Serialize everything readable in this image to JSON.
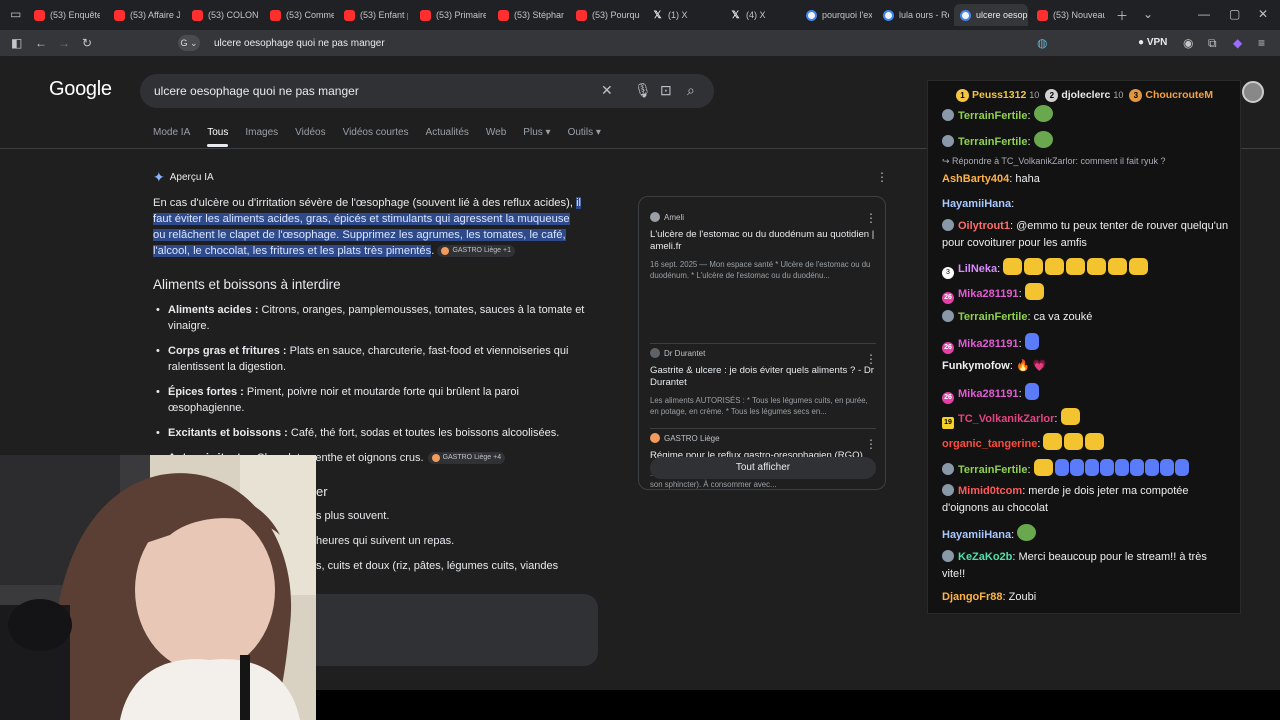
{
  "browser": {
    "tabs": [
      {
        "label": "(53) Enquête...",
        "icon": "youtube-icon",
        "left": 0
      },
      {
        "label": "(53) Affaire Je...",
        "icon": "youtube-icon"
      },
      {
        "label": "(53) COLONEL...",
        "icon": "youtube-icon"
      },
      {
        "label": "(53) Commen...",
        "icon": "youtube-icon"
      },
      {
        "label": "(53) Enfant pe...",
        "icon": "youtube-icon"
      },
      {
        "label": "(53) Primaire",
        "icon": "youtube-icon"
      },
      {
        "label": "(53) Stéphane...",
        "icon": "youtube-icon"
      },
      {
        "label": "(53) Pourquoi...",
        "icon": "youtube-icon"
      },
      {
        "label": "(1) X",
        "icon": "x-icon"
      },
      {
        "label": "(4) X",
        "icon": "x-icon"
      },
      {
        "label": "pourquoi l'ext...",
        "icon": "google-icon"
      },
      {
        "label": "lula ours - Re...",
        "icon": "google-icon"
      },
      {
        "label": "ulcere oesoph...",
        "icon": "google-icon",
        "active": true
      },
      {
        "label": "(53) Nouveau...",
        "icon": "youtube-icon"
      }
    ],
    "address_url": "ulcere oesophage quoi ne pas manger",
    "vpn_label": "VPN"
  },
  "google": {
    "logo": "Google",
    "query": "ulcere oesophage quoi ne pas manger",
    "nav_tabs": [
      "Mode IA",
      "Tous",
      "Images",
      "Vidéos",
      "Vidéos courtes",
      "Actualités",
      "Web",
      "Plus ▾",
      "Outils ▾"
    ],
    "ai_label": "Aperçu IA",
    "intro_plain": "En cas d'ulcère ou d'irritation sévère de l'œsophage (souvent lié à des reflux acides), ",
    "intro_highlight": "il faut éviter les aliments acides, gras, épicés et stimulants qui agressent la muqueuse ou relâchent le clapet de l'œsophage. Supprimez les agrumes, les tomates, le café, l'alcool, le chocolat, les fritures et les plats très pimentés",
    "intro_end": ".",
    "intro_chip": "GASTRO Liège +1",
    "section_title": "Aliments et boissons à interdire",
    "bullets": [
      {
        "bold": "Aliments acides :",
        "text": " Citrons, oranges, pamplemousses, tomates, sauces à la tomate et vinaigre."
      },
      {
        "bold": "Corps gras et fritures :",
        "text": " Plats en sauce, charcuterie, fast-food et viennoiseries qui ralentissent la digestion."
      },
      {
        "bold": "Épices fortes :",
        "text": " Piment, poivre noir et moutarde forte qui brûlent la paroi œsophagienne."
      },
      {
        "bold": "Excitants et boissons :",
        "text": " Café, thé fort, sodas et toutes les boissons alcoolisées."
      },
      {
        "bold": "Autres irritants :",
        "text": " Chocolat, menthe et oignons crus."
      }
    ],
    "bullet_chip": "GASTRO Liège +4",
    "partial_heading": "er",
    "partial_lines": [
      "s plus souvent.",
      "heures qui suivent un repas.",
      "s, cuits et doux (riz, pâtes, légumes cuits, viandes"
    ],
    "sources": [
      {
        "site": "Ameli",
        "title": "L'ulcère de l'estomac ou du duodénum au quotidien | ameli.fr",
        "desc": "16 sept. 2025 — Mon espace santé * Ulcère de l'estomac ou du duodénum. * L'ulcère de l'estomac ou du duodénu...",
        "color": "#9aa0a6"
      },
      {
        "site": "Dr Durantet",
        "title": "Gastrite & ulcere : je dois éviter quels aliments ? - Dr Durantet",
        "desc": "Les aliments AUTORISÉS : * Tous les légumes cuits, en purée, en potage, en crème. * Tous les légumes secs en...",
        "color": "#5f6368"
      },
      {
        "site": "GASTRO Liège",
        "title": "Régime pour le reflux gastro-oresophagien (RGO)",
        "desc": "... des lésions de l'œsophage et nuit au bon fonctionnement de son sphincter). À consommer avec...",
        "color": "#f29b5d"
      }
    ],
    "show_all": "Tout afficher"
  },
  "chat": {
    "top": [
      {
        "rank": "1",
        "name": "Peuss1312",
        "count": "10",
        "color": "#f5c542",
        "rank_color": "#f5c542"
      },
      {
        "rank": "2",
        "name": "djoleclerc",
        "count": "10",
        "color": "#e8e8e8",
        "rank_color": "#d0d0d0"
      },
      {
        "rank": "3",
        "name": "ChoucrouteM",
        "count": "",
        "color": "#f5a142",
        "rank_color": "#e2963f"
      }
    ],
    "messages": [
      {
        "user": "TerrainFertile",
        "color": "#8fd14f",
        "text": ":",
        "badge": "bot",
        "emotes": [
          "frog"
        ]
      },
      {
        "user": "TerrainFertile",
        "color": "#8fd14f",
        "text": ":",
        "badge": "bot",
        "emotes": [
          "frog"
        ]
      },
      {
        "reply": "↪ Répondre à TC_VolkanikZarlor: comment il fait ryuk ?"
      },
      {
        "user": "AshBarty404",
        "color": "#ffb347",
        "text": ": haha"
      },
      {
        "user": "HayamiiHana",
        "color": "#a9c7ff",
        "text": ":"
      },
      {
        "user": "Oilytrout1",
        "color": "#ff6b6b",
        "text": ": @emmo tu peux tenter de rouver quelqu'un pour covoiturer pour les amfis",
        "badge": "bot"
      },
      {
        "user": "LilNeka",
        "color": "#d68cff",
        "text": ":",
        "badge": "three",
        "badge_text": "3",
        "emotes": [
          "cat",
          "cat",
          "cat",
          "cat",
          "cat",
          "cat",
          "cat"
        ]
      },
      {
        "user": "Mika281191",
        "color": "#e05bd1",
        "text": ":",
        "badge": "sub",
        "badge_text": "26",
        "emotes": [
          "cat"
        ]
      },
      {
        "user": "TerrainFertile",
        "color": "#8fd14f",
        "text": ": ca va zouké",
        "badge": "bot"
      },
      {
        "user": "Mika281191",
        "color": "#e05bd1",
        "text": ":",
        "badge": "sub",
        "badge_text": "26",
        "emotes": [
          "blue"
        ]
      },
      {
        "user": "Funkymofow",
        "color": "#efeff1",
        "text": ": 🔥 💗"
      },
      {
        "user": "Mika281191",
        "color": "#e05bd1",
        "text": ":",
        "badge": "sub",
        "badge_text": "26",
        "emotes": [
          "blue"
        ]
      },
      {
        "user": "TC_VolkanikZarlor",
        "color": "#e5437f",
        "text": ":",
        "badge": "yel",
        "badge_text": "19",
        "emotes": [
          "cat"
        ]
      },
      {
        "user": "organic_tangerine",
        "color": "#ff4b3e",
        "text": ":",
        "emotes": [
          "cat",
          "cat",
          "cat"
        ]
      },
      {
        "user": "TerrainFertile",
        "color": "#8fd14f",
        "text": ":",
        "badge": "bot",
        "emotes": [
          "cat",
          "blue",
          "blue",
          "blue",
          "blue",
          "blue",
          "blue",
          "blue",
          "blue",
          "blue"
        ]
      },
      {
        "user": "Mimid0tcom",
        "color": "#ff5a5a",
        "text": ": merde je dois jeter ma compotée d'oignons au chocolat",
        "badge": "bot"
      },
      {
        "user": "HayamiiHana",
        "color": "#a9c7ff",
        "text": ":",
        "emotes": [
          "frog"
        ]
      },
      {
        "user": "KeZaKo2b",
        "color": "#4fe0a8",
        "text": ": Merci beaucoup pour le stream!! à très vite!!",
        "badge": "bot"
      },
      {
        "user": "DjangoFr88",
        "color": "#ffb347",
        "text": ": Zoubi"
      }
    ]
  }
}
